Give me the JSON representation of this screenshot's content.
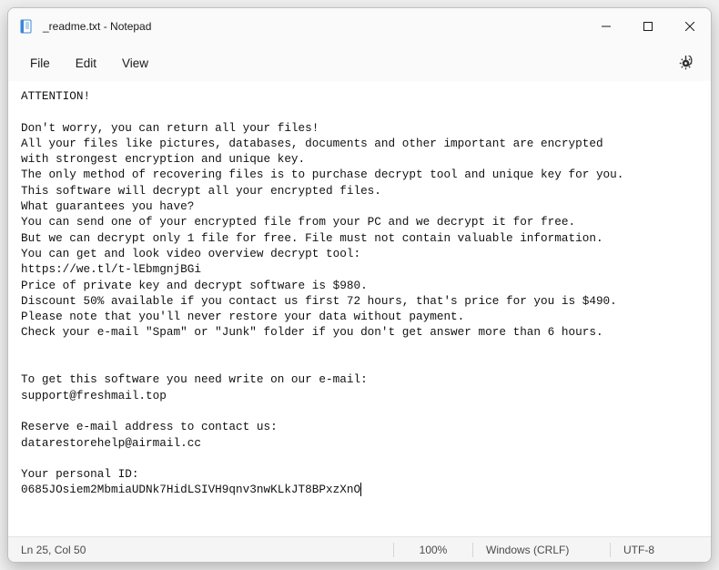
{
  "window": {
    "title": "_readme.txt - Notepad"
  },
  "menu": {
    "file": "File",
    "edit": "Edit",
    "view": "View"
  },
  "content": {
    "text": "ATTENTION!\n\nDon't worry, you can return all your files!\nAll your files like pictures, databases, documents and other important are encrypted\nwith strongest encryption and unique key.\nThe only method of recovering files is to purchase decrypt tool and unique key for you.\nThis software will decrypt all your encrypted files.\nWhat guarantees you have?\nYou can send one of your encrypted file from your PC and we decrypt it for free.\nBut we can decrypt only 1 file for free. File must not contain valuable information.\nYou can get and look video overview decrypt tool:\nhttps://we.tl/t-lEbmgnjBGi\nPrice of private key and decrypt software is $980.\nDiscount 50% available if you contact us first 72 hours, that's price for you is $490.\nPlease note that you'll never restore your data without payment.\nCheck your e-mail \"Spam\" or \"Junk\" folder if you don't get answer more than 6 hours.\n\n\nTo get this software you need write on our e-mail:\nsupport@freshmail.top\n\nReserve e-mail address to contact us:\ndatarestorehelp@airmail.cc\n\nYour personal ID:\n0685JOsiem2MbmiaUDNk7HidLSIVH9qnv3nwKLkJT8BPxzXnO"
  },
  "status": {
    "position": "Ln 25, Col 50",
    "zoom": "100%",
    "line_ending": "Windows (CRLF)",
    "encoding": "UTF-8"
  }
}
